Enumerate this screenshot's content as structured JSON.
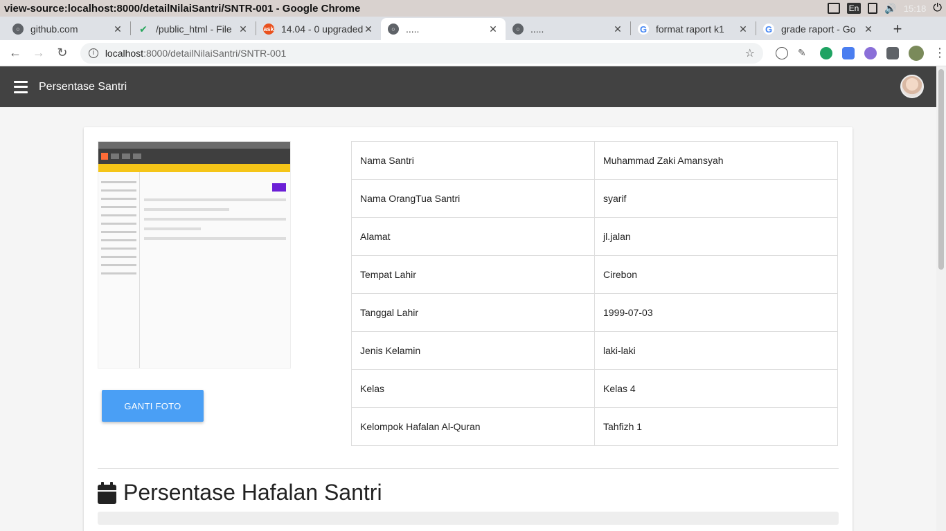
{
  "window": {
    "title": "view-source:localhost:8000/detailNilaiSantri/SNTR-001 - Google Chrome",
    "lang": "En",
    "time": "15:18"
  },
  "tabs": [
    {
      "label": "github.com",
      "icon": "globe-icon",
      "color": "#5f6368"
    },
    {
      "label": "/public_html - File",
      "icon": "check-icon",
      "color": "#26a65b"
    },
    {
      "label": "14.04 - 0 upgraded",
      "icon": "askubuntu-icon",
      "color": "#e9511e"
    },
    {
      "label": ".....",
      "icon": "globe-icon",
      "color": "#5f6368"
    },
    {
      "label": ".....",
      "icon": "globe-icon",
      "color": "#5f6368"
    },
    {
      "label": "format raport k1",
      "icon": "google-icon",
      "color": "#4285f4"
    },
    {
      "label": "grade raport - Go",
      "icon": "google-icon",
      "color": "#4285f4"
    }
  ],
  "toolbar": {
    "url_host": "localhost",
    "url_path": ":8000/detailNilaiSantri/SNTR-001"
  },
  "app": {
    "title": "Persentase Santri"
  },
  "profile": {
    "button_label": "GANTI FOTO",
    "rows": [
      {
        "label": "Nama Santri",
        "value": "Muhammad Zaki Amansyah"
      },
      {
        "label": "Nama OrangTua Santri",
        "value": "syarif"
      },
      {
        "label": "Alamat",
        "value": "jl.jalan"
      },
      {
        "label": "Tempat Lahir",
        "value": "Cirebon"
      },
      {
        "label": "Tanggal Lahir",
        "value": "1999-07-03"
      },
      {
        "label": "Jenis Kelamin",
        "value": "laki-laki"
      },
      {
        "label": "Kelas",
        "value": "Kelas 4"
      },
      {
        "label": "Kelompok Hafalan Al-Quran",
        "value": "Tahfizh 1"
      }
    ]
  },
  "section": {
    "title": "Persentase Hafalan Santri",
    "icon": "calendar-icon"
  },
  "colors": {
    "header_bg": "#424242",
    "button_bg": "#4a9ff5"
  }
}
